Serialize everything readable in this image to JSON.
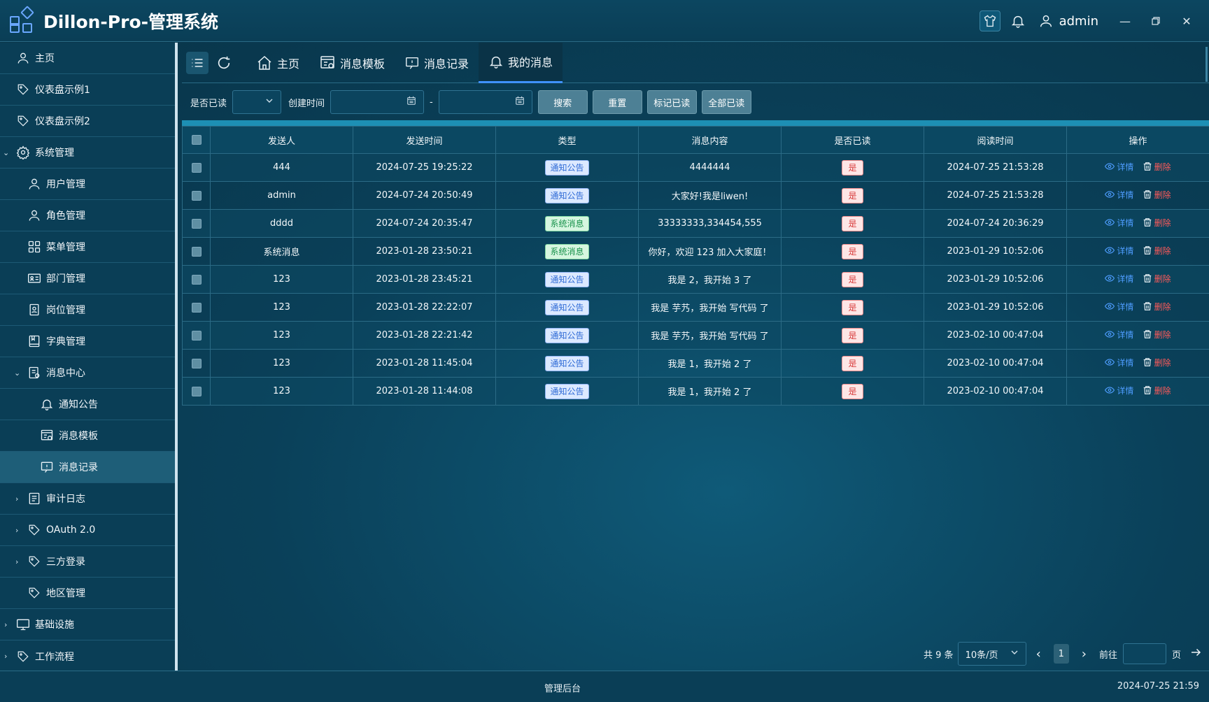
{
  "app": {
    "title": "Dillon-Pro-管理系统"
  },
  "header": {
    "user": "admin"
  },
  "sidebar": {
    "items": [
      {
        "label": "主页"
      },
      {
        "label": "仪表盘示例1"
      },
      {
        "label": "仪表盘示例2"
      },
      {
        "label": "系统管理"
      },
      {
        "label": "用户管理"
      },
      {
        "label": "角色管理"
      },
      {
        "label": "菜单管理"
      },
      {
        "label": "部门管理"
      },
      {
        "label": "岗位管理"
      },
      {
        "label": "字典管理"
      },
      {
        "label": "消息中心"
      },
      {
        "label": "通知公告"
      },
      {
        "label": "消息模板"
      },
      {
        "label": "消息记录"
      },
      {
        "label": "审计日志"
      },
      {
        "label": "OAuth 2.0"
      },
      {
        "label": "三方登录"
      },
      {
        "label": "地区管理"
      },
      {
        "label": "基础设施"
      },
      {
        "label": "工作流程"
      }
    ]
  },
  "tabs": [
    {
      "label": "主页"
    },
    {
      "label": "消息模板"
    },
    {
      "label": "消息记录"
    },
    {
      "label": "我的消息"
    }
  ],
  "filter": {
    "read_label": "是否已读",
    "created_label": "创建时间",
    "range_sep": "-",
    "search": "搜索",
    "reset": "重置",
    "mark_read": "标记已读",
    "mark_all_read": "全部已读"
  },
  "table": {
    "columns": [
      "发送人",
      "发送时间",
      "类型",
      "消息内容",
      "是否已读",
      "阅读时间",
      "操作"
    ],
    "op_view": "详情",
    "op_delete": "删除",
    "rows": [
      {
        "sender": "444",
        "sent": "2024-07-25 19:25:22",
        "type": "通知公告",
        "content": "4444444",
        "read": "是",
        "read_time": "2024-07-25 21:53:28"
      },
      {
        "sender": "admin",
        "sent": "2024-07-24 20:50:49",
        "type": "通知公告",
        "content": "大家好!我是liwen!",
        "read": "是",
        "read_time": "2024-07-25 21:53:28"
      },
      {
        "sender": "dddd",
        "sent": "2024-07-24 20:35:47",
        "type": "系统消息",
        "content": "33333333,334454,555",
        "read": "是",
        "read_time": "2024-07-24 20:36:29"
      },
      {
        "sender": "系统消息",
        "sent": "2023-01-28 23:50:21",
        "type": "系统消息",
        "content": "你好，欢迎 123 加入大家庭！",
        "read": "是",
        "read_time": "2023-01-29 10:52:06"
      },
      {
        "sender": "123",
        "sent": "2023-01-28 23:45:21",
        "type": "通知公告",
        "content": "我是 2，我开始 3 了",
        "read": "是",
        "read_time": "2023-01-29 10:52:06"
      },
      {
        "sender": "123",
        "sent": "2023-01-28 22:22:07",
        "type": "通知公告",
        "content": "我是 芋艿，我开始 写代码 了",
        "read": "是",
        "read_time": "2023-01-29 10:52:06"
      },
      {
        "sender": "123",
        "sent": "2023-01-28 22:21:42",
        "type": "通知公告",
        "content": "我是 芋艿，我开始 写代码 了",
        "read": "是",
        "read_time": "2023-02-10 00:47:04"
      },
      {
        "sender": "123",
        "sent": "2023-01-28 11:45:04",
        "type": "通知公告",
        "content": "我是 1，我开始 2 了",
        "read": "是",
        "read_time": "2023-02-10 00:47:04"
      },
      {
        "sender": "123",
        "sent": "2023-01-28 11:44:08",
        "type": "通知公告",
        "content": "我是 1，我开始 2 了",
        "read": "是",
        "read_time": "2023-02-10 00:47:04"
      }
    ]
  },
  "pager": {
    "total": "共 9 条",
    "size": "10条/页",
    "current": "1",
    "goto": "前往",
    "page_unit": "页"
  },
  "footer": {
    "center": "管理后台",
    "datetime": "2024-07-25 21:59"
  },
  "colors": {
    "accent": "#3f92ff",
    "danger": "#ff5a5a",
    "notice_tag": "#2f6bd6",
    "system_tag": "#18924b"
  }
}
